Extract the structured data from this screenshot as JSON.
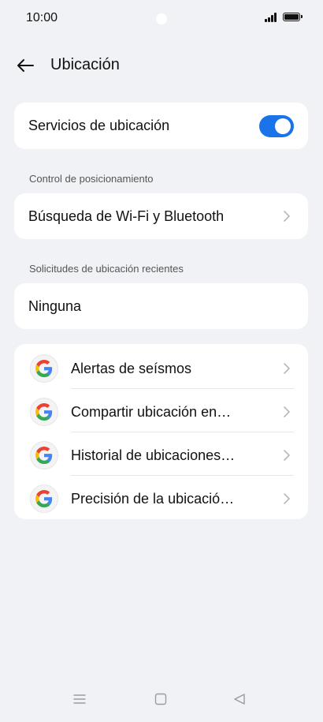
{
  "status_bar": {
    "time": "10:00",
    "signal_icon": "signal-icon",
    "battery_icon": "battery-icon"
  },
  "header": {
    "back_icon": "arrow-left-icon",
    "title": "Ubicación"
  },
  "location_services": {
    "label": "Servicios de ubicación",
    "enabled": true,
    "accent": "#1a73e8"
  },
  "positioning": {
    "section_title": "Control de posicionamiento",
    "wifi_bt_scan_label": "Búsqueda de Wi-Fi y Bluetooth"
  },
  "recent_requests": {
    "section_title": "Solicitudes de ubicación recientes",
    "value": "Ninguna"
  },
  "services": [
    {
      "label": "Alertas de seísmos",
      "icon": "google-g-icon"
    },
    {
      "label": "Compartir ubicación en…",
      "icon": "google-g-icon"
    },
    {
      "label": "Historial de ubicaciones…",
      "icon": "google-g-icon"
    },
    {
      "label": "Precisión de la ubicació…",
      "icon": "google-g-icon"
    }
  ],
  "nav_bar": {
    "menu_icon": "menu-icon",
    "home_icon": "home-icon",
    "back_icon": "back-triangle-icon"
  }
}
